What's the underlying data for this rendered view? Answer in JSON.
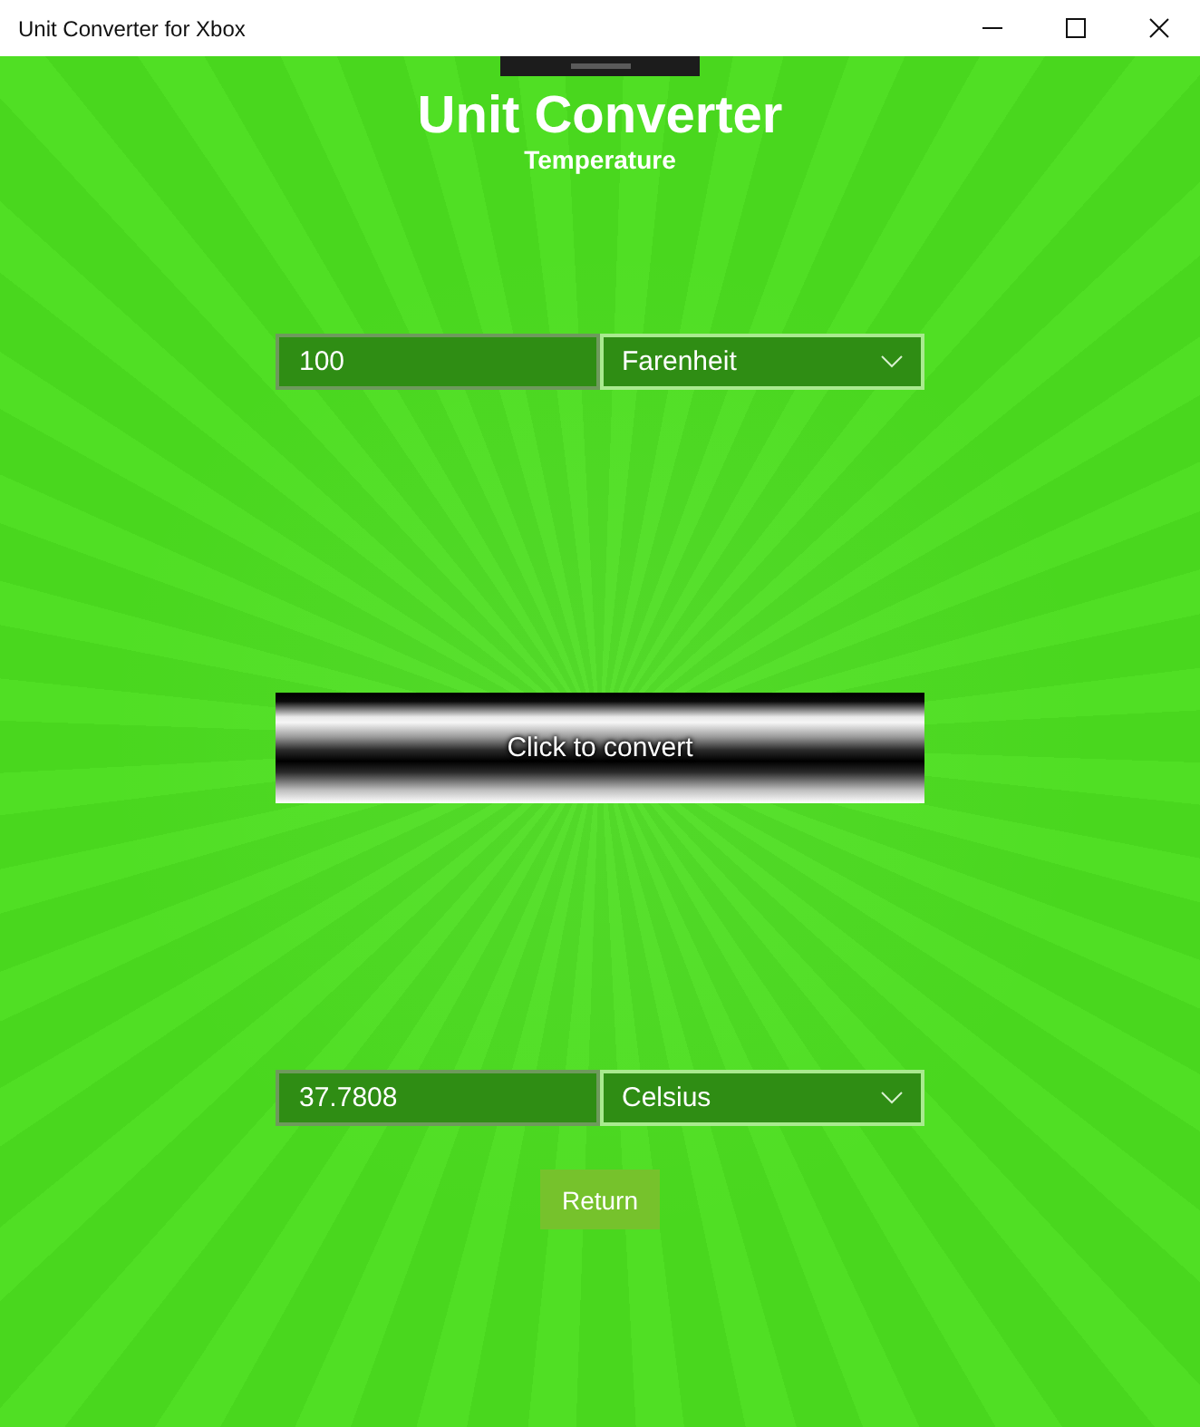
{
  "window": {
    "title": "Unit Converter for Xbox"
  },
  "header": {
    "title": "Unit Converter",
    "subtitle": "Temperature"
  },
  "input": {
    "value": "100",
    "unit": "Farenheit"
  },
  "convert_button": {
    "label": "Click to convert"
  },
  "output": {
    "value": "37.7808",
    "unit": "Celsius"
  },
  "return_button": {
    "label": "Return"
  }
}
